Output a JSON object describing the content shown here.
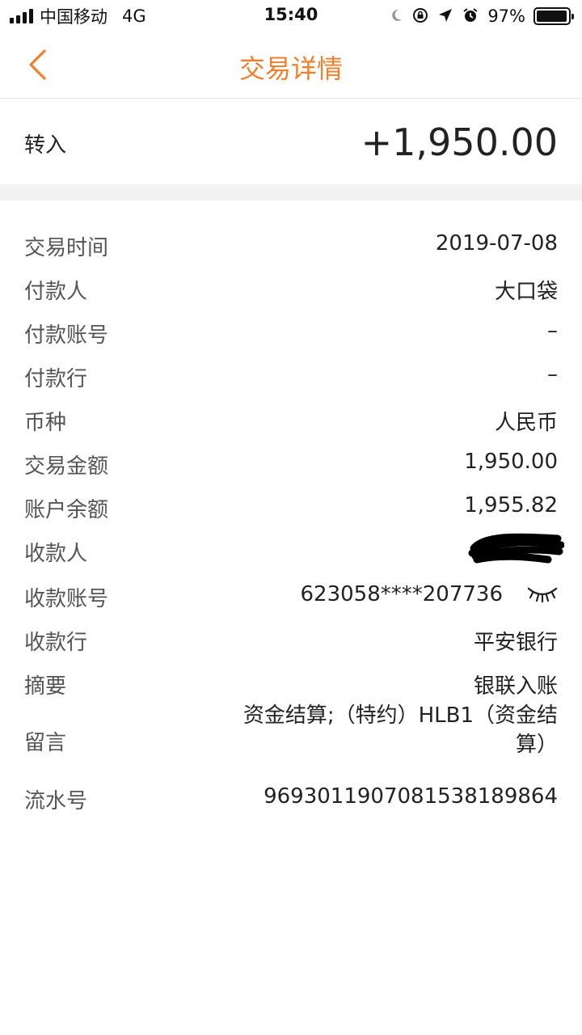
{
  "status": {
    "carrier": "中国移动",
    "network": "4G",
    "time": "15:40",
    "battery": "97%",
    "battery_level": 0.97
  },
  "nav": {
    "title": "交易详情",
    "back_icon": "chevron-left-icon"
  },
  "colors": {
    "accent": "#f07f2e"
  },
  "summary": {
    "label": "转入",
    "amount": "+1,950.00"
  },
  "details": [
    {
      "key": "time",
      "label": "交易时间",
      "value": "2019-07-08"
    },
    {
      "key": "payer",
      "label": "付款人",
      "value": "大口袋"
    },
    {
      "key": "payer-account",
      "label": "付款账号",
      "value": "–"
    },
    {
      "key": "payer-bank",
      "label": "付款行",
      "value": "–"
    },
    {
      "key": "currency",
      "label": "币种",
      "value": "人民币"
    },
    {
      "key": "amount",
      "label": "交易金额",
      "value": "1,950.00"
    },
    {
      "key": "balance",
      "label": "账户余额",
      "value": "1,955.82"
    },
    {
      "key": "payee",
      "label": "收款人",
      "value": ""
    },
    {
      "key": "payee-account",
      "label": "收款账号",
      "value": "623058****207736"
    },
    {
      "key": "payee-bank",
      "label": "收款行",
      "value": "平安银行"
    },
    {
      "key": "memo",
      "label": "摘要",
      "value": "银联入账"
    },
    {
      "key": "message",
      "label": "留言",
      "value_line1": "资金结算;（特约）HLB1（资金结",
      "value_line2": "算）"
    },
    {
      "key": "serial",
      "label": "流水号",
      "value": "969301190708153818986​4"
    }
  ]
}
